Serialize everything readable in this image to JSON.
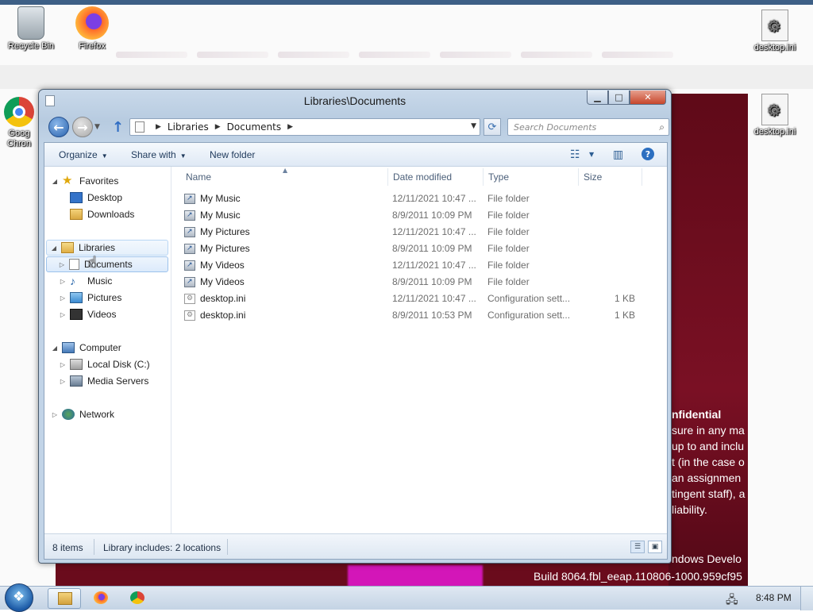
{
  "desktop": {
    "icons": [
      {
        "label": "Recycle Bin",
        "icon": "recycle-bin-icon"
      },
      {
        "label": "Firefox",
        "icon": "firefox-icon"
      },
      {
        "label": "Goog Chron",
        "icon": "chrome-icon"
      },
      {
        "label": "desktop.ini",
        "icon": "ini-file-icon"
      },
      {
        "label": "desktop.ini",
        "icon": "ini-file-icon"
      }
    ],
    "background_text": {
      "confidential_heading": "nfidential",
      "confidential_lines": [
        "sure in any ma",
        "up to and inclu",
        "t (in the case o",
        " an assignmen",
        "tingent staff), a",
        "liability."
      ],
      "windows_developer": "ndows Develo",
      "build": "Build 8064.fbl_eeap.110806-1000.959cf95"
    },
    "colors": {
      "background_accent": "#6a0b1c",
      "magenta_accent": "#d316b8"
    }
  },
  "window": {
    "title": "Libraries\\Documents",
    "caption_buttons": {
      "minimize": "▁",
      "maximize": "□",
      "close": "✕"
    },
    "address": {
      "crumbs": [
        "Libraries",
        "Documents"
      ]
    },
    "search": {
      "placeholder": "Search Documents"
    },
    "toolbar": {
      "organize": "Organize",
      "share_with": "Share with",
      "new_folder": "New folder"
    },
    "nav_tree": {
      "favorites": {
        "label": "Favorites",
        "children": [
          "Desktop",
          "Downloads"
        ]
      },
      "libraries": {
        "label": "Libraries",
        "children": [
          "Documents",
          "Music",
          "Pictures",
          "Videos"
        ]
      },
      "computer": {
        "label": "Computer",
        "children": [
          "Local Disk (C:)",
          "Media Servers"
        ]
      },
      "network": {
        "label": "Network"
      }
    },
    "columns": {
      "name": "Name",
      "date_modified": "Date modified",
      "type": "Type",
      "size": "Size"
    },
    "files": [
      {
        "name": "My Music",
        "date": "12/11/2021 10:47 ...",
        "type": "File folder",
        "size": "",
        "icon": "folder-shortcut-icon"
      },
      {
        "name": "My Music",
        "date": "8/9/2011 10:09 PM",
        "type": "File folder",
        "size": "",
        "icon": "folder-shortcut-icon"
      },
      {
        "name": "My Pictures",
        "date": "12/11/2021 10:47 ...",
        "type": "File folder",
        "size": "",
        "icon": "folder-shortcut-icon"
      },
      {
        "name": "My Pictures",
        "date": "8/9/2011 10:09 PM",
        "type": "File folder",
        "size": "",
        "icon": "folder-shortcut-icon"
      },
      {
        "name": "My Videos",
        "date": "12/11/2021 10:47 ...",
        "type": "File folder",
        "size": "",
        "icon": "folder-shortcut-icon"
      },
      {
        "name": "My Videos",
        "date": "8/9/2011 10:09 PM",
        "type": "File folder",
        "size": "",
        "icon": "folder-shortcut-icon"
      },
      {
        "name": "desktop.ini",
        "date": "12/11/2021 10:47 ...",
        "type": "Configuration sett...",
        "size": "1 KB",
        "icon": "ini-file-icon"
      },
      {
        "name": "desktop.ini",
        "date": "8/9/2011 10:53 PM",
        "type": "Configuration sett...",
        "size": "1 KB",
        "icon": "ini-file-icon"
      }
    ],
    "status": {
      "item_count": "8 items",
      "library_info": "Library includes: 2 locations"
    }
  },
  "taskbar": {
    "apps": [
      "Windows Explorer",
      "Firefox",
      "Google Chrome"
    ],
    "clock": "8:48 PM"
  }
}
